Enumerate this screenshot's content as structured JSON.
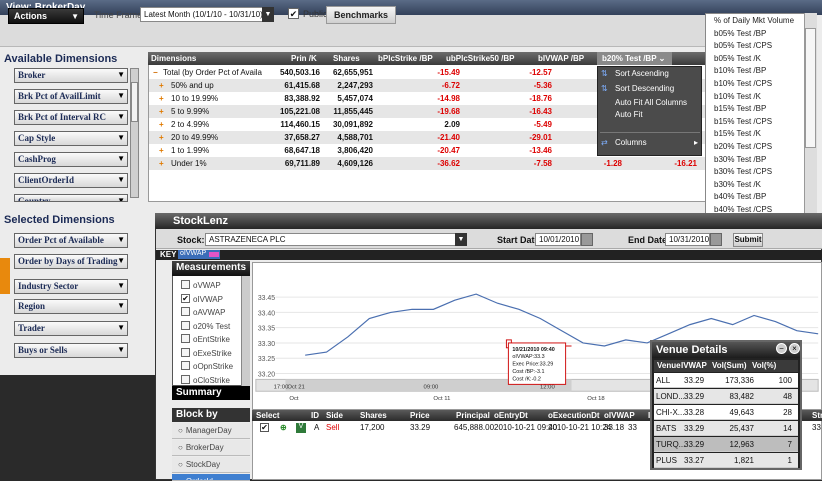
{
  "main": {
    "title": "View: BrokerDay",
    "actions_label": "Actions",
    "timeframe_label": "Time Frame :",
    "timeframe_value": "Latest Month (10/1/10 - 10/31/10)",
    "public_label": "Public",
    "public_checked": "✔",
    "benchmarks_label": "Benchmarks",
    "available_title": "Available Dimensions",
    "available": [
      "Broker",
      "Brk Pct of AvailLimit",
      "Brk Pct of Interval RC",
      "Cap Style",
      "CashProg",
      "ClientOrderId",
      "Country"
    ],
    "selected_title": "Selected Dimensions",
    "selected": [
      "Order Pct of Available",
      "Order by Days of Trading",
      "Industry Sector",
      "Region",
      "Trader",
      "Buys or Sells"
    ]
  },
  "grid": {
    "headers": [
      "Dimensions",
      "Prin /K",
      "Shares",
      "bPlcStrike /BP",
      "ubPlcStrike50 /BP",
      "bIVWAP /BP",
      "b20% Test /BP"
    ],
    "rows": [
      {
        "sign": "−",
        "dim": "Total (by Order Pct of Availa",
        "prin": "540,503.16",
        "shares": "62,655,951",
        "b1": "-15.49",
        "b2": "-12.57",
        "b3": "4.79",
        "b4": ""
      },
      {
        "sign": "+",
        "dim": "50% and up",
        "prin": "61,415.68",
        "shares": "2,247,293",
        "b1": "-6.72",
        "b2": "-5.36",
        "b3": "-0.34",
        "b4": ""
      },
      {
        "sign": "+",
        "dim": "10 to 19.99%",
        "prin": "83,388.92",
        "shares": "5,457,074",
        "b1": "-14.98",
        "b2": "-18.76",
        "b3": "7.42",
        "b4": ""
      },
      {
        "sign": "+",
        "dim": "5 to 9.99%",
        "prin": "105,221.08",
        "shares": "11,855,445",
        "b1": "-19.68",
        "b2": "-16.43",
        "b3": "5.62",
        "b4": ""
      },
      {
        "sign": "+",
        "dim": "2 to 4.99%",
        "prin": "114,460.15",
        "shares": "30,091,892",
        "b1": "2.09",
        "b2": "-5.49",
        "b3": "3.14",
        "b4": ""
      },
      {
        "sign": "+",
        "dim": "20 to 49.99%",
        "prin": "37,658.27",
        "shares": "4,588,701",
        "b1": "-21.40",
        "b2": "-29.01",
        "b3": "6.18",
        "b4": ""
      },
      {
        "sign": "+",
        "dim": "1 to 1.99%",
        "prin": "68,647.18",
        "shares": "3,806,420",
        "b1": "-20.47",
        "b2": "-13.46",
        "b3": "13.04",
        "b4": "-8.54"
      },
      {
        "sign": "+",
        "dim": "Under 1%",
        "prin": "69,711.89",
        "shares": "4,609,126",
        "b1": "-36.62",
        "b2": "-7.58",
        "b3": "-1.28",
        "b4": "-16.21"
      }
    ],
    "menu": [
      "Sort Ascending",
      "Sort Descending",
      "Auto Fit All Columns",
      "Auto Fit",
      "Columns"
    ]
  },
  "measure_list": [
    "% of Daily Mkt Volume",
    "b05% Test /BP",
    "b05% Test /CPS",
    "b05% Test /K",
    "b10% Test /BP",
    "b10% Test /CPS",
    "b10% Test /K",
    "b15% Test /BP",
    "b15% Test /CPS",
    "b15% Test /K",
    "b20% Test /CPS",
    "b30% Test /BP",
    "b30% Test /CPS",
    "b30% Test /K",
    "b40% Test /BP",
    "b40% Test /CPS"
  ],
  "stocklenz": {
    "title": "StockLenz",
    "stock_label": "Stock:",
    "stock_value": "ASTRAZENECA PLC",
    "start_label": "Start Date:",
    "start_value": "10/01/2010",
    "end_label": "End Date:",
    "end_value": "10/31/2010",
    "submit_label": "Submit",
    "key_label": "KEY",
    "key_tag": "oIVWAP",
    "measurements_title": "Measurements",
    "measurements": [
      {
        "checked": "",
        "label": "oVWAP"
      },
      {
        "checked": "✔",
        "label": "oIVWAP"
      },
      {
        "checked": "",
        "label": "oAVWAP"
      },
      {
        "checked": "",
        "label": "o20% Test"
      },
      {
        "checked": "",
        "label": "oEntStrike"
      },
      {
        "checked": "",
        "label": "oExeStrike"
      },
      {
        "checked": "",
        "label": "oOpnStrike"
      },
      {
        "checked": "",
        "label": "oCloStrike"
      }
    ],
    "summary_title": "Summary",
    "blockby_title": "Block by",
    "blockby": [
      "ManagerDay",
      "BrokerDay",
      "StockDay",
      "OrderId"
    ],
    "chart_data": {
      "type": "line",
      "ylim": [
        33.2,
        33.5
      ],
      "yticks": [
        "33.45",
        "33.40",
        "33.35",
        "33.30",
        "33.25",
        "33.20"
      ],
      "xticks_top": [
        "17:00",
        "Oct 21",
        "09:00",
        "12:00",
        "15:00"
      ],
      "xticks_bottom": [
        "Oct",
        "Oct 11",
        "Oct 18"
      ],
      "values": [
        33.26,
        33.27,
        33.32,
        33.38,
        33.4,
        33.41,
        33.41,
        33.44,
        33.46,
        33.43,
        33.41,
        33.38,
        33.34,
        33.3,
        33.29,
        33.31,
        33.3,
        33.33,
        33.36,
        33.38,
        33.36,
        33.39,
        33.37,
        33.34,
        33.33
      ],
      "tooltip": [
        "10/21/2010 09:40",
        "oIVWAP:33.3",
        "Exec Price:33.29",
        "Cost /BP:-3.1",
        "Cost /K:-0.2"
      ]
    },
    "orders_headers": [
      "Select",
      "ID",
      "Side",
      "Shares",
      "Price",
      "Principal",
      "oEntryDt",
      "oExecutionDt",
      "oIVWAP",
      "IVWAP",
      "Strik"
    ],
    "order_row": {
      "id": "A",
      "side": "Sell",
      "shares": "17,200",
      "price": "33.29",
      "principal": "645,888.00",
      "entry": "2010-10-21 09:40",
      "exec": "2010-10-21 10:24",
      "oivwap": "33.18",
      "ivwap": "33",
      "strike": "33"
    }
  },
  "venue": {
    "title": "Venue Details",
    "headers": [
      "Venue",
      "IVWAP",
      "Vol(Sum)",
      "Vol(%)"
    ],
    "rows": [
      {
        "venue": "ALL",
        "ivwap": "33.29",
        "vol": "173,336",
        "pct": "100"
      },
      {
        "venue": "LOND...",
        "ivwap": "33.29",
        "vol": "83,482",
        "pct": "48"
      },
      {
        "venue": "CHI-X...",
        "ivwap": "33.28",
        "vol": "49,643",
        "pct": "28"
      },
      {
        "venue": "BATS",
        "ivwap": "33.29",
        "vol": "25,437",
        "pct": "14"
      },
      {
        "venue": "TURQ...",
        "ivwap": "33.29",
        "vol": "12,963",
        "pct": "7"
      },
      {
        "venue": "PLUS",
        "ivwap": "33.27",
        "vol": "1,821",
        "pct": "1"
      }
    ]
  },
  "colors": {
    "accent": "#e8890d",
    "negative": "#dd0000",
    "chart_line": "#4a6fb0",
    "tooltip": "#d01010"
  }
}
